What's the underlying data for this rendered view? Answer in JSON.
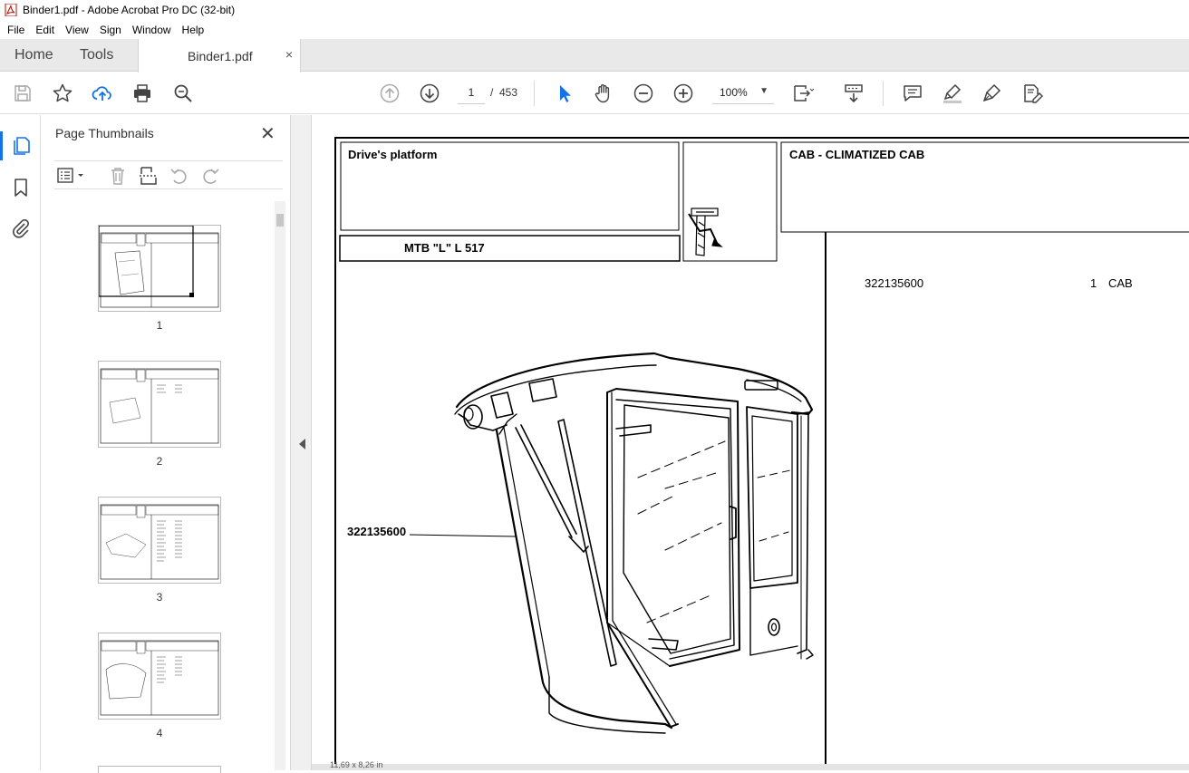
{
  "window": {
    "title": "Binder1.pdf - Adobe Acrobat Pro DC (32-bit)"
  },
  "menu": [
    "File",
    "Edit",
    "View",
    "Sign",
    "Window",
    "Help"
  ],
  "tabs": {
    "home": "Home",
    "tools": "Tools",
    "document": "Binder1.pdf",
    "close_glyph": "×"
  },
  "toolbar": {
    "current_page": "1",
    "page_separator": "/",
    "total_pages": "453",
    "zoom": "100%",
    "icons": [
      "save-icon",
      "star-icon",
      "upload-icon",
      "print-icon",
      "search-icon",
      "prev-page-icon",
      "next-page-icon",
      "select-arrow-icon",
      "hand-icon",
      "zoom-out-icon",
      "zoom-in-icon",
      "fit-page-icon",
      "scroll-mode-icon",
      "comment-icon",
      "highlight-icon",
      "sign-icon",
      "more-tools-icon"
    ]
  },
  "thumbnails_panel": {
    "title": "Page Thumbnails",
    "close_glyph": "✕",
    "pages": [
      "1",
      "2",
      "3",
      "4"
    ]
  },
  "document": {
    "header_left": "Drive's platform",
    "header_model": "MTB \"L\" L 517",
    "header_right": "CAB - CLIMATIZED CAB",
    "part_number": "322135600",
    "callout_label": "322135600",
    "quantity": "1",
    "description": "CAB"
  },
  "status": {
    "page_size": "11,69 x 8,26 in"
  }
}
